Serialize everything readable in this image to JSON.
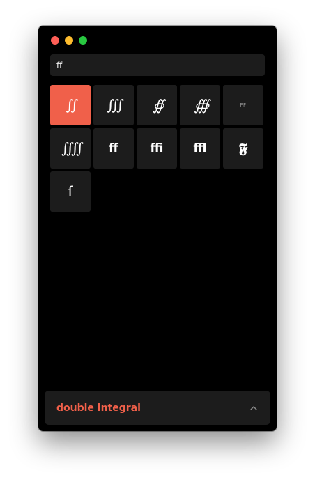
{
  "window": {
    "traffic_lights": [
      "close",
      "minimize",
      "maximize"
    ]
  },
  "search": {
    "value": "ff"
  },
  "results": [
    {
      "glyph": "∬",
      "style": "integral"
    },
    {
      "glyph": "∭",
      "style": "integral"
    },
    {
      "glyph": "∯",
      "style": "integral"
    },
    {
      "glyph": "∰",
      "style": "integral"
    },
    {
      "glyph": "FF",
      "style": "small"
    },
    {
      "glyph": "⨌",
      "style": "integral4"
    },
    {
      "glyph": "ﬀ",
      "style": "lig"
    },
    {
      "glyph": "ﬃ",
      "style": "lig"
    },
    {
      "glyph": "ﬄ",
      "style": "lig"
    },
    {
      "glyph": "𝕱",
      "style": "blackletter"
    },
    {
      "glyph": "ſ",
      "style": "longs"
    }
  ],
  "selected_index": 0,
  "footer": {
    "name": "double integral",
    "icon": "chevron-up-icon"
  },
  "colors": {
    "accent": "#f0604a",
    "tile": "#1c1c1c",
    "background": "#000000"
  }
}
